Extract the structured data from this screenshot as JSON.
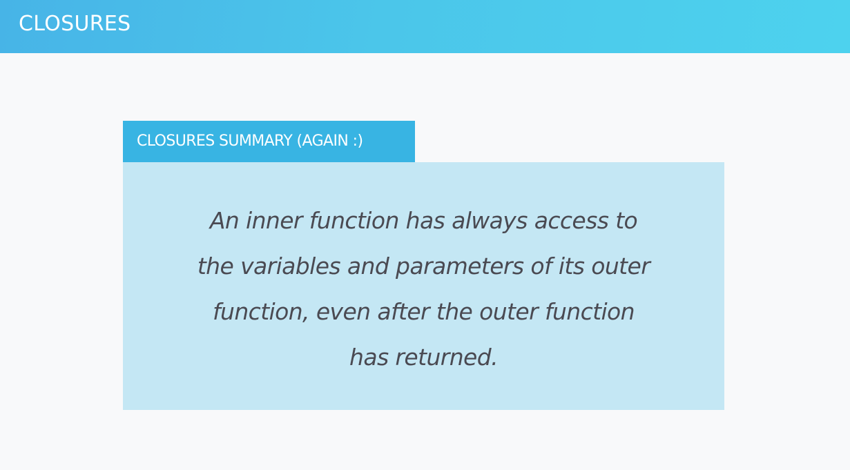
{
  "header": {
    "title": "CLOSURES"
  },
  "summary": {
    "tab_label": "CLOSURES SUMMARY (AGAIN :)",
    "lines": [
      "An inner function has always access to",
      "the variables and parameters of its outer",
      "function, even after the outer function",
      "has returned."
    ]
  },
  "colors": {
    "header_gradient_start": "#47b4e7",
    "header_gradient_end": "#4dd2ee",
    "tab_background": "#38b4e3",
    "box_background": "#c4e7f4",
    "body_text": "#4a4a52",
    "page_background": "#f8f9fa"
  }
}
